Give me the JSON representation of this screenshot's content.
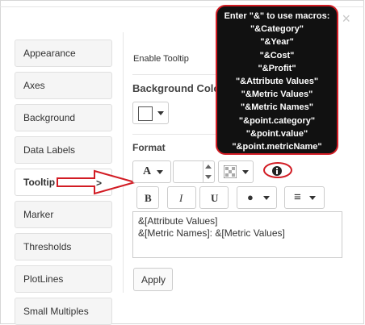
{
  "sidebar": {
    "items": [
      {
        "label": "Appearance"
      },
      {
        "label": "Axes"
      },
      {
        "label": "Background"
      },
      {
        "label": "Data Labels"
      },
      {
        "label": "Tooltip"
      },
      {
        "label": "Marker"
      },
      {
        "label": "Thresholds"
      },
      {
        "label": "PlotLines"
      },
      {
        "label": "Small Multiples"
      }
    ],
    "active": "Tooltip"
  },
  "pointer_label": ">",
  "enable_tooltip_label": "Enable Tooltip",
  "background_color": {
    "label": "Background Color",
    "swatch_color": "#ffffff"
  },
  "format": {
    "label": "Format",
    "font_glyph": "A",
    "size_value": "",
    "info_icon": "info-circle-icon",
    "bold_label": "B",
    "italic_label": "I",
    "underline_label": "U",
    "bullet_glyph": "●",
    "align_glyph": "≡",
    "template_text": "&[Attribute Values]\n&[Metric Names]: &[Metric Values]"
  },
  "apply_label": "Apply",
  "macro_tooltip": {
    "lines": [
      "Enter \"&\" to use macros:",
      "\"&Category\"",
      "\"&Year\"",
      "\"&Cost\"",
      "\"&Profit\"",
      "\"&Attribute Values\"",
      "\"&Metric Values\"",
      "\"&Metric Names\"",
      "\"&point.category\"",
      "\"&point.value\"",
      "\"&point.metricName\""
    ]
  },
  "colors": {
    "highlight": "#d21c24",
    "tooltip_bg": "#111111"
  }
}
